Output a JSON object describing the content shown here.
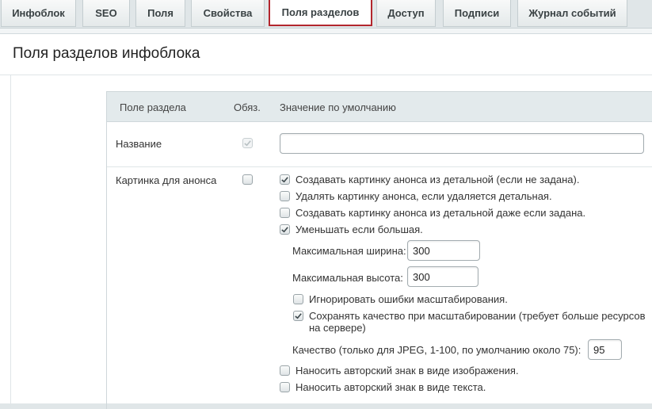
{
  "tabs": [
    {
      "label": "Инфоблок"
    },
    {
      "label": "SEO"
    },
    {
      "label": "Поля"
    },
    {
      "label": "Свойства"
    },
    {
      "label": "Поля разделов"
    },
    {
      "label": "Доступ"
    },
    {
      "label": "Подписи"
    },
    {
      "label": "Журнал событий"
    }
  ],
  "active_tab": "Поля разделов",
  "accent_color": "#b3262d",
  "page": {
    "title": "Поля разделов инфоблока"
  },
  "table": {
    "headers": {
      "field": "Поле раздела",
      "required": "Обяз.",
      "default": "Значение по умолчанию"
    },
    "rows": [
      {
        "label": "Название",
        "required": true,
        "required_disabled": true,
        "value": ""
      },
      {
        "label": "Картинка для анонса",
        "required": false
      }
    ]
  },
  "preview_image": {
    "options": [
      {
        "label": "Создавать картинку анонса из детальной (если не задана).",
        "checked": true
      },
      {
        "label": "Удалять картинку анонса, если удаляется детальная.",
        "checked": false
      },
      {
        "label": "Создавать картинку анонса из детальной даже если задана.",
        "checked": false
      },
      {
        "label": "Уменьшать если большая.",
        "checked": true
      }
    ],
    "max_width_label": "Максимальная ширина:",
    "max_width": "300",
    "max_height_label": "Максимальная высота:",
    "max_height": "300",
    "ignore_errors": {
      "label": "Игнорировать ошибки масштабирования.",
      "checked": false
    },
    "keep_quality": {
      "label_line1": "Сохранять качество при масштабировании (требует больше ресурсов",
      "label_line2": "на сервере)",
      "checked": true
    },
    "quality_label": "Качество (только для JPEG, 1-100, по умолчанию около 75):",
    "quality": "95",
    "watermark_image": {
      "label": "Наносить авторский знак в виде изображения.",
      "checked": false
    },
    "watermark_text": {
      "label": "Наносить авторский знак в виде текста.",
      "checked": false
    }
  }
}
